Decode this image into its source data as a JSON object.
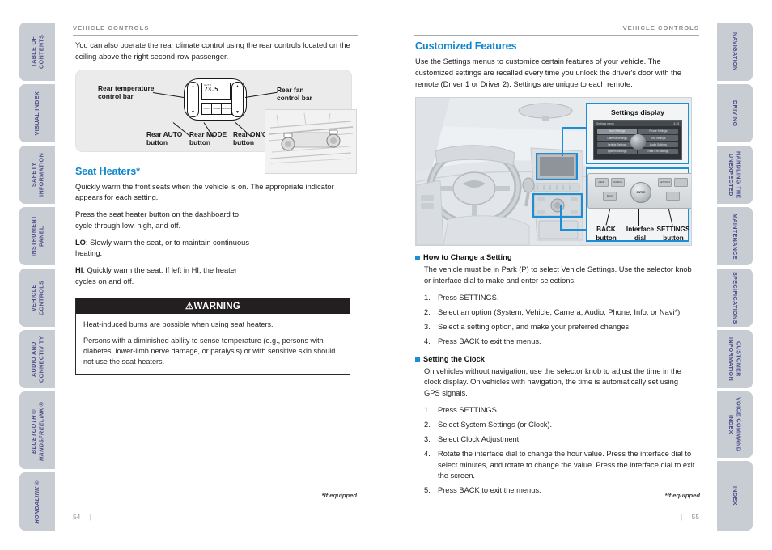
{
  "left_rail": {
    "tabs": [
      {
        "label": "TABLE OF CONTENTS"
      },
      {
        "label": "VISUAL INDEX"
      },
      {
        "label": "SAFETY INFORMATION"
      },
      {
        "label": "INSTRUMENT PANEL"
      },
      {
        "label": "VEHICLE CONTROLS"
      },
      {
        "label": "AUDIO AND CONNECTIVITY"
      },
      {
        "label": "BLUETOOTH® HANDSFREELINK®"
      },
      {
        "label": "HONDALINK®"
      }
    ]
  },
  "right_rail": {
    "tabs": [
      {
        "label": "NAVIGATION"
      },
      {
        "label": "DRIVING"
      },
      {
        "label": "HANDLING THE UNEXPECTED"
      },
      {
        "label": "MAINTENANCE"
      },
      {
        "label": "SPECIFICATIONS"
      },
      {
        "label": "CUSTOMER INFORMATION"
      },
      {
        "label": "VOICE COMMAND INDEX"
      },
      {
        "label": "INDEX"
      }
    ]
  },
  "left_page": {
    "header": "VEHICLE CONTROLS",
    "intro": "You can also operate the rear climate control using the rear controls located on the ceiling above the right second-row passenger.",
    "rear_figure": {
      "label_temp": "Rear temperature control bar",
      "label_fan": "Rear fan control bar",
      "label_auto": "Rear AUTO button",
      "label_mode": "Rear MODE button",
      "label_onoff": "Rear ON/OFF button",
      "lcd_top": "AUTO",
      "lcd_value": "73.5",
      "btn_auto": "AUTO",
      "btn_mode": "MODE",
      "btn_onoff": "ON/OFF",
      "arrow_up": "▲",
      "arrow_down": "▼"
    },
    "seat_heaters": {
      "title": "Seat Heaters*",
      "p1": "Quickly warm the front seats when the vehicle is on. The appropriate indicator appears for each setting.",
      "p2": "Press the seat heater button on the dashboard to cycle through low, high, and off.",
      "p3_label": "LO",
      "p3": ": Slowly warm the seat, or to maintain continuous heating.",
      "p4_label": "HI",
      "p4": ": Quickly warm the seat. If left in HI, the heater cycles on and off."
    },
    "warning": {
      "title": "⚠WARNING",
      "p1": "Heat-induced burns are possible when using seat heaters.",
      "p2": "Persons with a diminished ability to sense temperature (e.g., persons with diabetes, lower-limb nerve damage, or paralysis) or with sensitive skin should not use the seat heaters."
    },
    "footnote": "*If equipped",
    "page_number": "54"
  },
  "right_page": {
    "header": "VEHICLE CONTROLS",
    "title": "Customized Features",
    "intro": "Use the Settings menus to customize certain features of your vehicle. The customized settings are recalled every time you unlock the driver's door with the remote (Driver 1 or Driver 2). Settings are unique to each remote.",
    "figure": {
      "settings_display_title": "Settings display",
      "screen_title": "Settings menu",
      "screen_time": "4:15",
      "screen_cells": [
        "Navi Settings",
        "Phone Settings",
        "Camera Settings",
        "Info Settings",
        "Vehicle Settings",
        "Audio Settings",
        "System Settings",
        "Rear Ent Settings"
      ],
      "audio_dial_label": "ENTER",
      "audio_btn_back": "BACK",
      "audio_btn_settings": "SETTINGS",
      "audio_btn_menu": "MENU",
      "audio_btn_source": "SOURCE",
      "label_back": "BACK button",
      "label_dial": "Interface dial",
      "label_settings": "SETTINGS button"
    },
    "how_to_change": {
      "heading": "How to Change a Setting",
      "body": "The vehicle must be in Park (P) to select Vehicle Settings. Use the selector knob or interface dial to make and enter selections.",
      "steps": [
        "Press SETTINGS.",
        "Select an option (System, Vehicle, Camera, Audio, Phone, Info, or Navi*).",
        "Select a setting option, and make your preferred changes.",
        "Press BACK to exit the menus."
      ]
    },
    "setting_clock": {
      "heading": "Setting the Clock",
      "body": "On vehicles without navigation, use the selector knob to adjust the time in the clock display. On vehicles with navigation, the time is automatically set using GPS signals.",
      "steps": [
        "Press SETTINGS.",
        "Select System Settings (or Clock).",
        "Select Clock Adjustment.",
        "Rotate the interface dial to change the hour value. Press the interface dial to select minutes, and rotate to change the value. Press the interface dial to exit the screen.",
        "Press BACK to exit the menus."
      ]
    },
    "footnote": "*If equipped",
    "page_number": "55"
  },
  "colors": {
    "accent_blue": "#0e86cd",
    "callout_blue": "#1b8fd6",
    "tab_bg": "#c8ccd3",
    "tab_text": "#4a4f8c",
    "header_gray": "#8b8d90",
    "warning_bg": "#231f20"
  }
}
